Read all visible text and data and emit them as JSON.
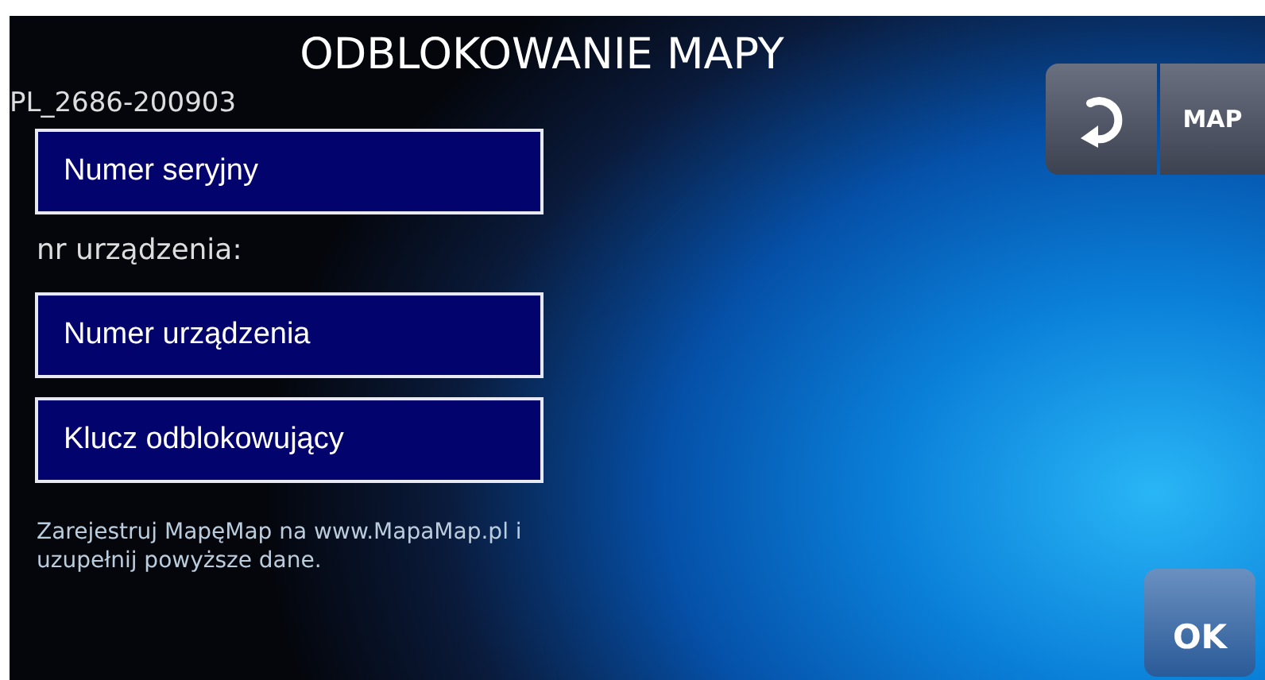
{
  "title": "ODBLOKOWANIE MAPY",
  "map_id": "PL_2686-200903",
  "fields": [
    {
      "kind": "field",
      "placeholder": "Numer seryjny"
    },
    {
      "kind": "label",
      "text": "nr urządzenia:"
    },
    {
      "kind": "field",
      "placeholder": "Numer urządzenia"
    },
    {
      "kind": "field",
      "placeholder": "Klucz odblokowujący"
    }
  ],
  "help_text": "Zarejestruj MapęMap na www.MapaMap.pl i uzupełnij powyższe dane.",
  "top_buttons": [
    {
      "kind": "icon"
    },
    {
      "kind": "text",
      "label": "MAP"
    }
  ],
  "ok_button": "OK"
}
